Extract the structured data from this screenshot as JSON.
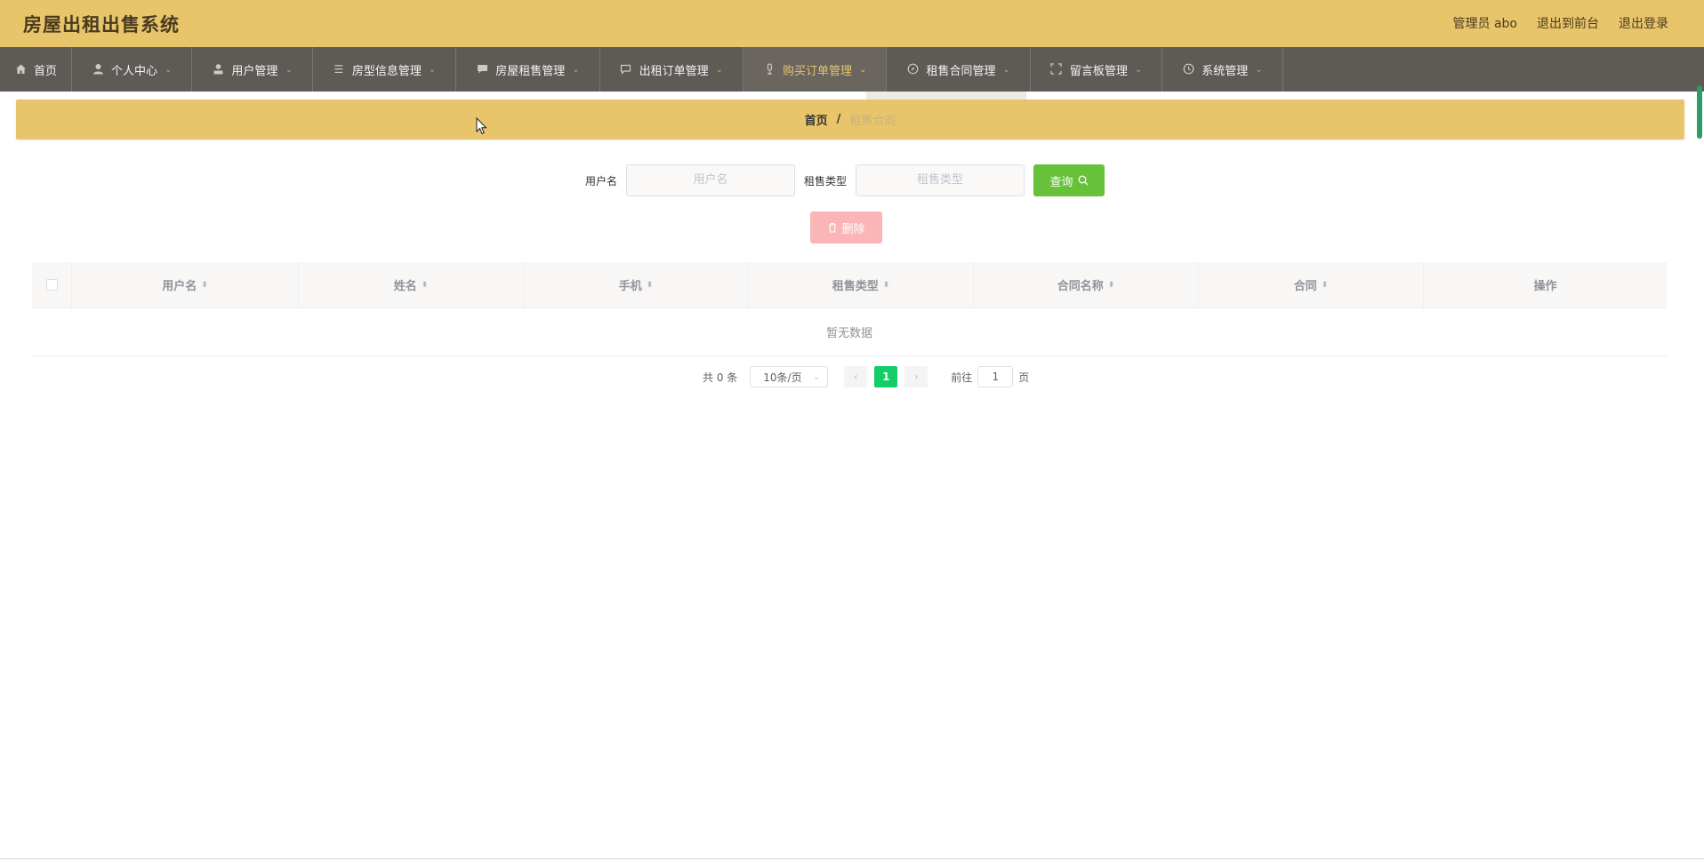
{
  "header": {
    "title": "房屋出租出售系统",
    "links": [
      "管理员 abo",
      "退出到前台",
      "退出登录"
    ]
  },
  "nav": {
    "items": [
      {
        "label": "首页",
        "icon": "home-icon",
        "caret": false,
        "active": false
      },
      {
        "label": "个人中心",
        "icon": "user-icon",
        "caret": true,
        "active": false
      },
      {
        "label": "用户管理",
        "icon": "user-manage-icon",
        "caret": true,
        "active": false
      },
      {
        "label": "房型信息管理",
        "icon": "list-icon",
        "caret": true,
        "active": false
      },
      {
        "label": "房屋租售管理",
        "icon": "chat-icon",
        "caret": true,
        "active": false
      },
      {
        "label": "出租订单管理",
        "icon": "message-icon",
        "caret": true,
        "active": false
      },
      {
        "label": "购买订单管理",
        "icon": "microphone-icon",
        "caret": true,
        "active": true
      },
      {
        "label": "租售合同管理",
        "icon": "compass-icon",
        "caret": true,
        "active": false
      },
      {
        "label": "留言板管理",
        "icon": "fullscreen-icon",
        "caret": true,
        "active": false
      },
      {
        "label": "系统管理",
        "icon": "clock-icon",
        "caret": true,
        "active": false
      }
    ]
  },
  "breadcrumb": {
    "home": "首页",
    "separator": "/",
    "current": "租售合同"
  },
  "search": {
    "username_label": "用户名",
    "username_placeholder": "用户名",
    "type_label": "租售类型",
    "type_placeholder": "租售类型",
    "query_label": "查询"
  },
  "actions": {
    "delete_label": "删除"
  },
  "table": {
    "columns": [
      "用户名",
      "姓名",
      "手机",
      "租售类型",
      "合同名称",
      "合同",
      "操作"
    ],
    "empty_text": "暂无数据"
  },
  "pagination": {
    "total_text": "共 0 条",
    "page_size": "10条/页",
    "current_page": "1",
    "goto_label": "前往",
    "goto_value": "1",
    "page_suffix": "页"
  },
  "colors": {
    "header_bg": "#e8c56b",
    "nav_bg": "#5e5a55",
    "active_nav_text": "#e8c56b",
    "query_button": "#67c23a",
    "delete_button": "#fab6b6",
    "page_active": "#13ce66"
  }
}
